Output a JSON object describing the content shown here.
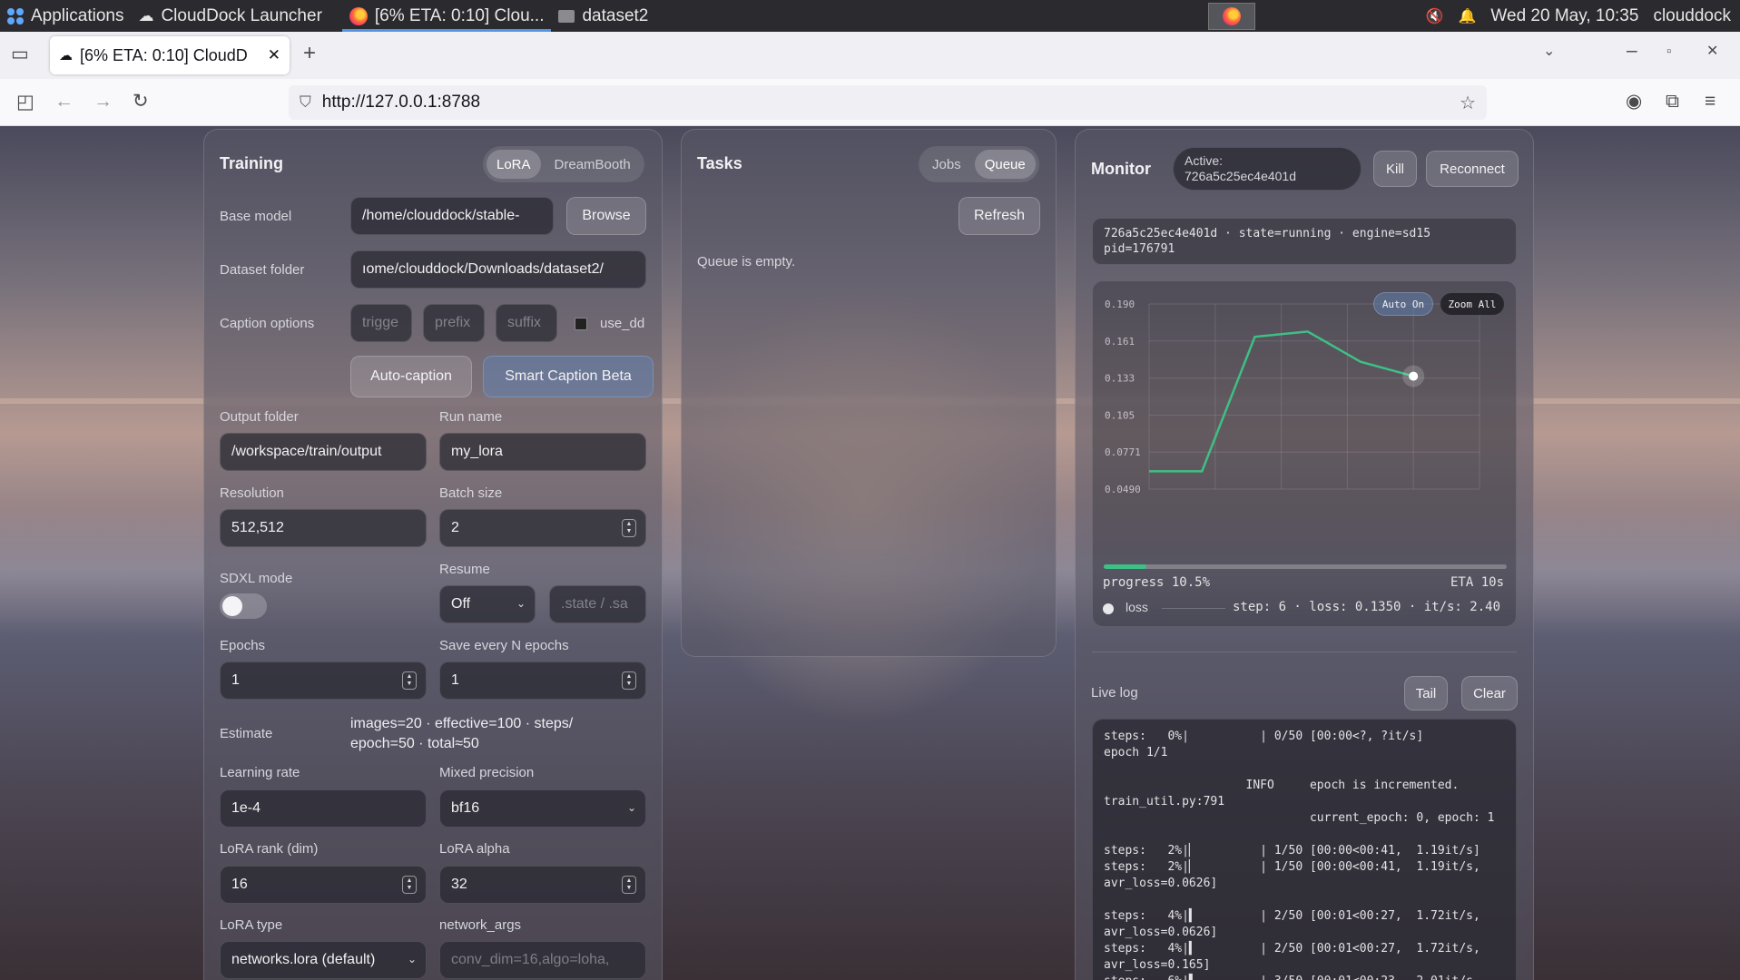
{
  "system_bar": {
    "applications": "Applications",
    "launcher": "CloudDock Launcher",
    "browser_task": "[6% ETA: 0:10] Clou...",
    "folder_task": "dataset2",
    "clock": "Wed 20 May, 10:35",
    "user": "clouddock"
  },
  "browser": {
    "tab_title": "[6% ETA: 0:10] CloudD",
    "url": "http://127.0.0.1:8788"
  },
  "training": {
    "title": "Training",
    "modes": [
      "LoRA",
      "DreamBooth"
    ],
    "base_model_label": "Base model",
    "base_model_value": "/home/clouddock/stable-",
    "browse": "Browse",
    "dataset_label": "Dataset folder",
    "dataset_value": "ıome/clouddock/Downloads/dataset2/",
    "caption_label": "Caption options",
    "trigger_ph": "trigge",
    "prefix_ph": "prefix",
    "suffix_ph": "suffix",
    "use_dd": "use_dd",
    "auto_caption": "Auto-caption",
    "smart_caption": "Smart Caption Beta",
    "output_label": "Output folder",
    "output_value": "/workspace/train/output",
    "run_label": "Run name",
    "run_value": "my_lora",
    "resolution_label": "Resolution",
    "resolution_value": "512,512",
    "batch_label": "Batch size",
    "batch_value": "2",
    "sdxl_label": "SDXL mode",
    "resume_label": "Resume",
    "resume_value": "Off",
    "resume_ph": ".state / .sa",
    "epochs_label": "Epochs",
    "epochs_value": "1",
    "save_label": "Save every N epochs",
    "save_value": "1",
    "estimate_label": "Estimate",
    "estimate_line1": "images=20 · effective=100 · steps/",
    "estimate_line2": "epoch=50 · total≈50",
    "lr_label": "Learning rate",
    "lr_value": "1e-4",
    "mp_label": "Mixed precision",
    "mp_value": "bf16",
    "rank_label": "LoRA rank (dim)",
    "rank_value": "16",
    "alpha_label": "LoRA alpha",
    "alpha_value": "32",
    "type_label": "LoRA type",
    "type_value": "networks.lora (default)",
    "netargs_label": "network_args",
    "netargs_ph": "conv_dim=16,algo=loha,"
  },
  "tasks": {
    "title": "Tasks",
    "modes": [
      "Jobs",
      "Queue"
    ],
    "refresh": "Refresh",
    "empty": "Queue is empty."
  },
  "monitor": {
    "title": "Monitor",
    "active_line1": "Active:",
    "active_line2": "726a5c25ec4e401d",
    "kill": "Kill",
    "reconnect": "Reconnect",
    "status_line1": "726a5c25ec4e401d · state=running · engine=sd15",
    "status_line2": "pid=176791",
    "auto_on": "Auto On",
    "zoom_all": "Zoom All",
    "progress_text": "progress 10.5%",
    "progress_fraction": 0.105,
    "eta": "ETA 10s",
    "legend": "loss",
    "step_info": "step: 6 · loss: 0.1350 · it/s: 2.40",
    "live_log": "Live log",
    "tail": "Tail",
    "clear": "Clear",
    "log": "steps:   0%|          | 0/50 [00:00<?, ?it/s]\nepoch 1/1\n\n                    INFO     epoch is incremented.\ntrain_util.py:791\n                             current_epoch: 0, epoch: 1\n\nsteps:   2%|▏         | 1/50 [00:00<00:41,  1.19it/s]\nsteps:   2%|▏         | 1/50 [00:00<00:41,  1.19it/s,\navr_loss=0.0626]\n\nsteps:   4%|▍         | 2/50 [00:01<00:27,  1.72it/s,\navr_loss=0.0626]\nsteps:   4%|▍         | 2/50 [00:01<00:27,  1.72it/s,\navr_loss=0.165]\nsteps:   6%|▌         | 3/50 [00:01<00:23,  2.01it/s,"
  },
  "chart_data": {
    "type": "line",
    "title": "",
    "xlabel": "",
    "ylabel": "",
    "y_ticks": [
      "0.190",
      "0.161",
      "0.133",
      "0.105",
      "0.0771",
      "0.0490"
    ],
    "ylim": [
      0.049,
      0.19
    ],
    "grid": true,
    "series": [
      {
        "name": "loss",
        "x": [
          1,
          2,
          3,
          4,
          5,
          6
        ],
        "values": [
          0.0626,
          0.0626,
          0.165,
          0.169,
          0.146,
          0.135
        ]
      }
    ]
  }
}
